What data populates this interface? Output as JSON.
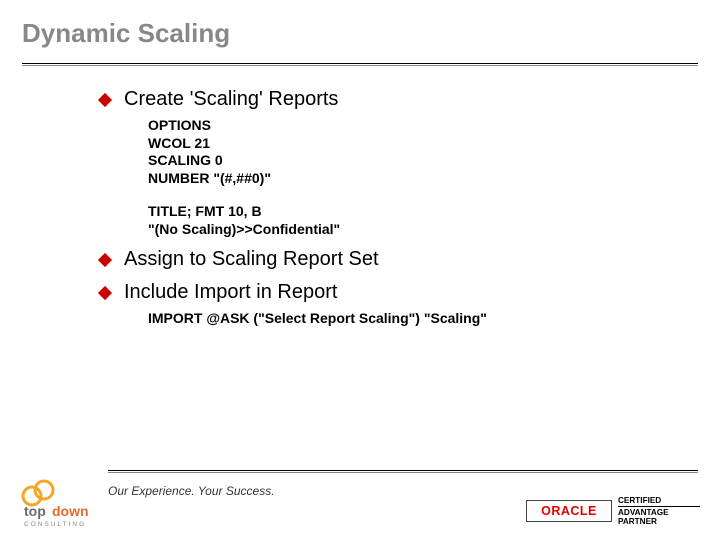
{
  "title": "Dynamic Scaling",
  "bullets": [
    {
      "text": "Create 'Scaling' Reports"
    },
    {
      "text": "Assign to Scaling Report Set"
    },
    {
      "text": "Include Import in Report"
    }
  ],
  "code1": "OPTIONS\nWCOL 21\nSCALING 0\nNUMBER \"(#,##0)\"",
  "code2": "TITLE; FMT 10, B\n\"(No Scaling)>>Confidential\"",
  "code3": "IMPORT @ASK (\"Select Report Scaling\") \"Scaling\"",
  "footer": {
    "tagline": "Our Experience. Your Success.",
    "oracle": "ORACLE",
    "cert1": "CERTIFIED",
    "cert2": "ADVANTAGE",
    "cert3": "PARTNER",
    "topdown": "topdown",
    "consulting": "CONSULTING"
  }
}
